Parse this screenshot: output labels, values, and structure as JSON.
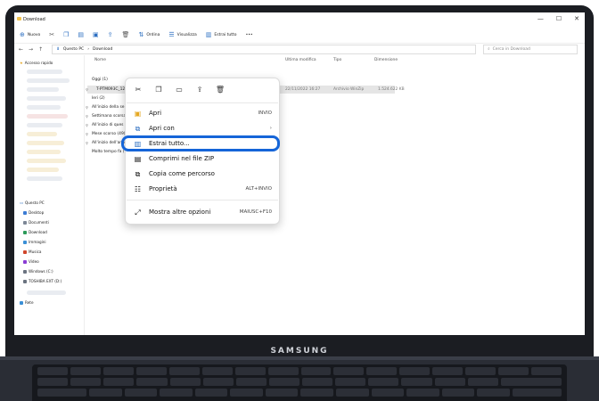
{
  "window": {
    "title": "Download",
    "min": "—",
    "max": "☐",
    "close": "✕"
  },
  "commandbar": {
    "new_label": "Nuovo",
    "sort_label": "Ordina",
    "view_label": "Visualizza",
    "extract_label": "Estrai tutto",
    "more_label": "•••"
  },
  "address": {
    "path_root": "Questo PC",
    "path_current": "Download",
    "search_placeholder": "Cerca in Download"
  },
  "sidebar": {
    "quick_access": "Accesso rapido",
    "this_pc": "Questo PC",
    "items": [
      "Desktop",
      "Documenti",
      "Download",
      "Immagini",
      "Musica",
      "Video",
      "Windows (C:)",
      "TOSHIBA EXT (D:)"
    ],
    "network": "Rete"
  },
  "columns": {
    "name": "Nome",
    "modified": "Ultima modifica",
    "type": "Tipo",
    "size": "Dimensione"
  },
  "rows": {
    "group_today": "Oggi (1)",
    "file_name": "T-PTM093C_1264.1.058 EN",
    "file_date": "22/11/2022 16:27",
    "file_type": "Archivio WinZip",
    "file_size": "1.524.622 KB",
    "group_yesterday": "Ieri (2)",
    "group_earlier_week": "All'inizio della se",
    "group_last_week": "Settimana scorsa",
    "group_earlier_month": "All'inizio di ques",
    "group_last_month": "Mese scorso (49)",
    "group_earlier_year": "All'inizio dell'ann",
    "group_long_ago": "Molto tempo fa (7"
  },
  "menu": {
    "open": "Apri",
    "open_short": "INVIO",
    "open_with": "Apri con",
    "extract_all": "Estrai tutto...",
    "compress_zip": "Comprimi nel file ZIP",
    "copy_path": "Copia come percorso",
    "properties": "Proprietà",
    "properties_short": "ALT+INVIO",
    "more_options": "Mostra altre opzioni",
    "more_options_short": "MAIUSC+F10"
  },
  "device": {
    "brand": "SAMSUNG"
  },
  "colors": {
    "accent": "#1565d8",
    "bezel": "#1b1d22"
  }
}
